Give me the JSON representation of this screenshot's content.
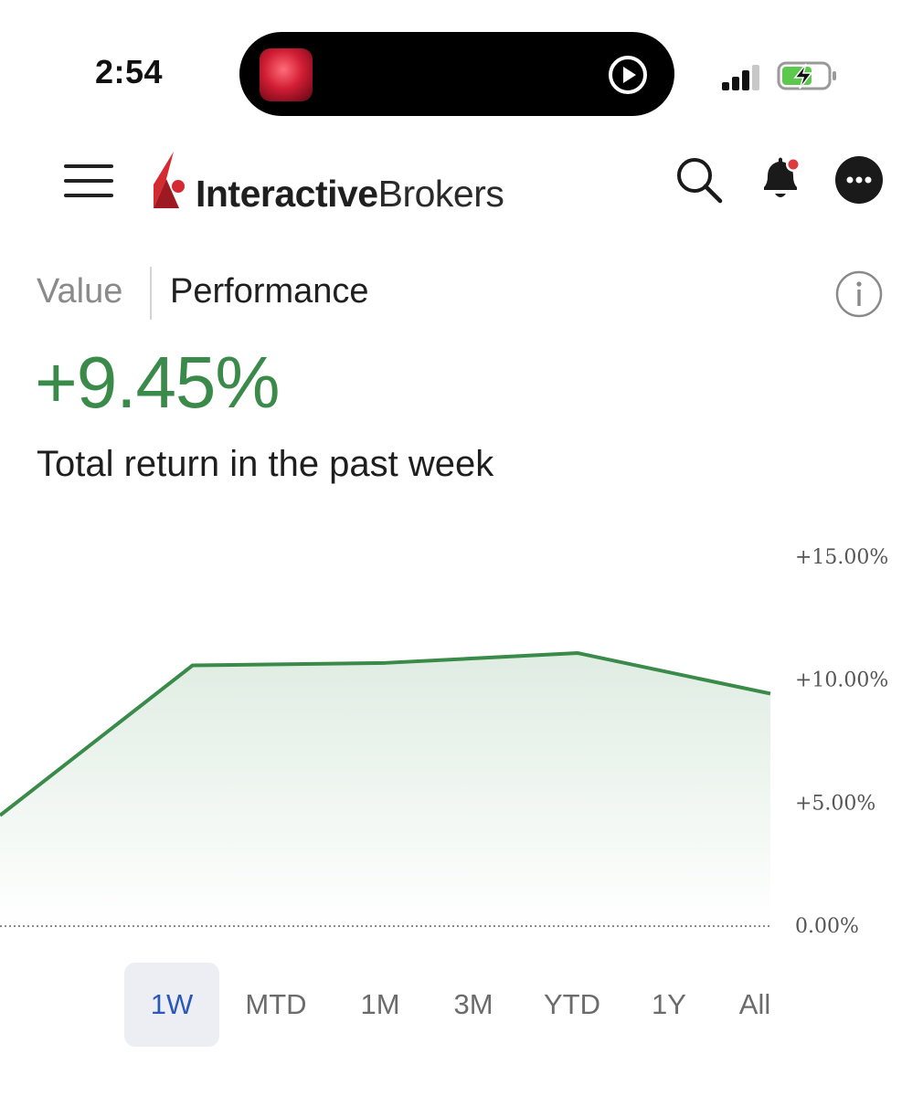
{
  "status_bar": {
    "time": "2:54"
  },
  "header": {
    "brand_bold": "Interactive",
    "brand_regular": "Brokers"
  },
  "tabs": [
    {
      "label": "Value",
      "active": false
    },
    {
      "label": "Performance",
      "active": true
    }
  ],
  "summary": {
    "return_value": "+9.45%",
    "return_label": "Total return in the past week",
    "color": "#3a8a4a"
  },
  "chart_data": {
    "type": "area",
    "y_ticks": [
      "+15.00%",
      "+10.00%",
      "+5.00%",
      "0.00%"
    ],
    "ylim": [
      0,
      15
    ],
    "xlim": [
      0,
      4
    ],
    "series": [
      {
        "x": [
          0,
          1,
          2,
          3,
          4
        ],
        "values": [
          4.5,
          10.6,
          10.7,
          11.1,
          9.45
        ]
      }
    ],
    "line_color": "#3a8a4a",
    "baseline": "dotted",
    "grid": false
  },
  "ranges": [
    {
      "label": "1W",
      "active": true
    },
    {
      "label": "MTD",
      "active": false
    },
    {
      "label": "1M",
      "active": false
    },
    {
      "label": "3M",
      "active": false
    },
    {
      "label": "YTD",
      "active": false
    },
    {
      "label": "1Y",
      "active": false
    },
    {
      "label": "All",
      "active": false
    }
  ]
}
